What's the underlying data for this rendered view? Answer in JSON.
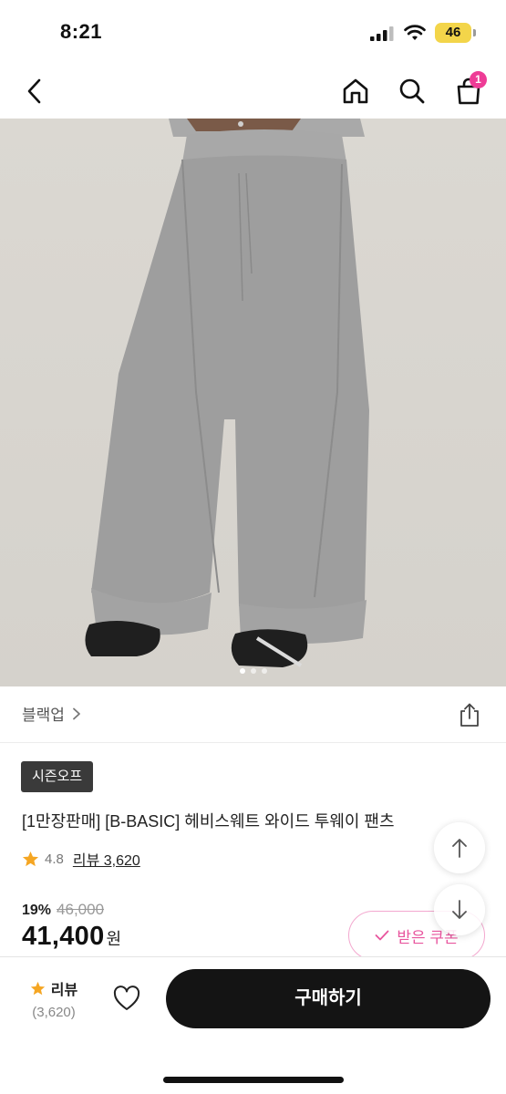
{
  "status_bar": {
    "time": "8:21",
    "battery": "46",
    "icons": [
      "cellular-signal-icon",
      "wifi-icon",
      "battery-icon"
    ]
  },
  "nav": {
    "icons": [
      "chevron-left-icon",
      "home-icon",
      "search-icon",
      "shopping-bag-icon"
    ],
    "cart_count": "1"
  },
  "image_carousel": {
    "dot_count": 3,
    "active_index": 0
  },
  "product": {
    "brand": "블랙업",
    "badge": "시즌오프",
    "title": "[1만장판매] [B-BASIC] 헤비스웨트 와이드 투웨이 팬츠",
    "rating": "4.8",
    "review_label": "리뷰 3,620",
    "discount_rate": "19%",
    "original_price": "46,000",
    "sale_price": "41,400",
    "currency": "원"
  },
  "coupon": {
    "label": "받은 쿠폰",
    "icon": "check-icon"
  },
  "bottom_bar": {
    "review_label": "리뷰",
    "review_count": "(3,620)",
    "buy_label": "구매하기",
    "icons": [
      "star-icon",
      "heart-icon"
    ]
  },
  "colors": {
    "accent_pink": "#ee3c96",
    "rating_star": "#f5a623",
    "buy_button": "#141414",
    "badge_bg": "#3a3a3a",
    "battery": "#f3d54a"
  }
}
